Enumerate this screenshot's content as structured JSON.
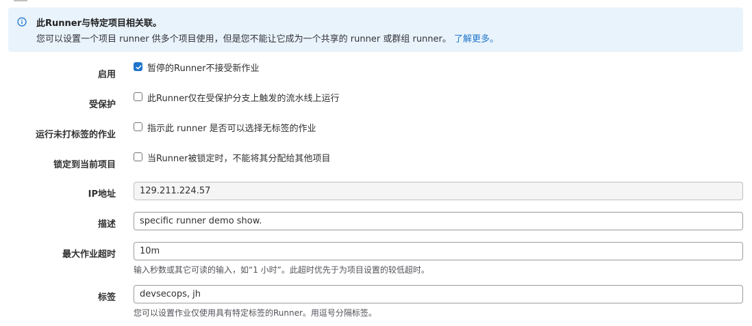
{
  "alert": {
    "icon": "info-circle-icon",
    "title": "此Runner与特定项目相关联。",
    "body": "您可以设置一个项目 runner 供多个项目使用，但是您不能让它成为一个共享的 runner 或群组 runner。",
    "link": "了解更多。"
  },
  "fields": {
    "active": {
      "label": "启用",
      "text": "暂停的Runner不接受新作业",
      "checked": true
    },
    "protected": {
      "label": "受保护",
      "text": "此Runner仅在受保护分支上触发的流水线上运行",
      "checked": false
    },
    "run_untagged": {
      "label": "运行未打标签的作业",
      "text": "指示此 runner 是否可以选择无标签的作业",
      "checked": false
    },
    "locked": {
      "label": "锁定到当前项目",
      "text": "当Runner被锁定时，不能将其分配给其他项目",
      "checked": false
    },
    "ip_address": {
      "label": "IP地址",
      "value": "129.211.224.57"
    },
    "description": {
      "label": "描述",
      "value": "specific runner demo show."
    },
    "max_timeout": {
      "label": "最大作业超时",
      "value": "10m",
      "help": "输入秒数或其它可读的输入，如“1 小时”。此超时优先于为项目设置的较低超时。"
    },
    "tags": {
      "label": "标签",
      "value": "devsecops, jh",
      "help": "您可以设置作业仅使用具有特定标签的Runner。用逗号分隔标签。"
    }
  },
  "colors": {
    "alert_bg": "#e9f3fc",
    "link": "#1f75cb",
    "checkbox_checked": "#1f75cb"
  }
}
